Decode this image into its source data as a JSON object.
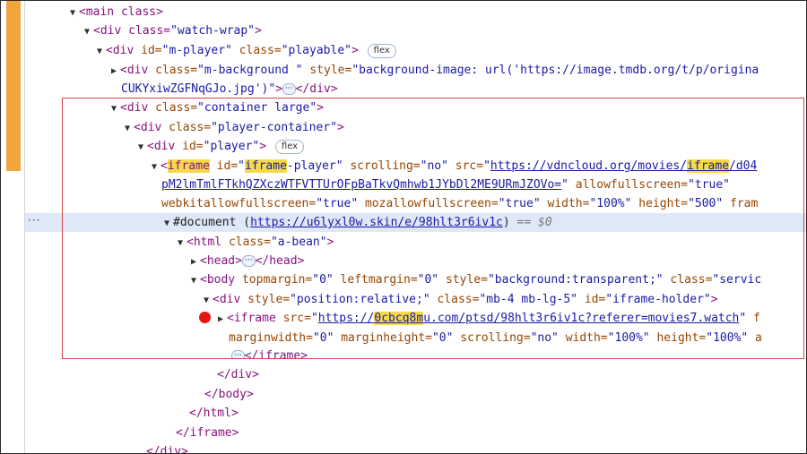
{
  "colors": {
    "tag": "#881280",
    "attr": "#994500",
    "value": "#1a1aa6",
    "highlight": "#f5d949",
    "selected_row": "#dfe8f7",
    "breakpoint": "#e31414",
    "annotation_box": "#d64545",
    "gutter_bar": "#f2a53a"
  },
  "gutter": {
    "dots": "···"
  },
  "badges": {
    "flex": "flex",
    "ellipsis": "···"
  },
  "lines": [
    {
      "t1": "<main class>"
    },
    {
      "t1": "<div class=",
      "v1": "\"watch-wrap\"",
      "t2": ">"
    },
    {
      "t1": "<div ",
      "a1": "id=",
      "v1": "\"m-player\"",
      "a2": " class=",
      "v2": "\"playable\"",
      "t2": ">"
    },
    {
      "t1": "<div ",
      "a1": "class=",
      "v1": "\"m-background \"",
      "a2": " style=",
      "v2": "\"background-image: url('https://image.tmdb.org/t/p/origina"
    },
    {
      "v1": "CUKYxiwZGFNqGJo.jpg')\"",
      "t1": ">",
      "t2": "</div>"
    },
    {
      "t1": "<div ",
      "a1": "class=",
      "v1": "\"container large\"",
      "t2": ">"
    },
    {
      "t1": "<div ",
      "a1": "class=",
      "v1": "\"player-container\"",
      "t2": ">"
    },
    {
      "t1": "<div ",
      "a1": "id=",
      "v1": "\"player\"",
      "t2": ">"
    },
    {
      "t1": "<",
      "h1": "iframe",
      "a1": " id=",
      "v1": "\"",
      "h2": "iframe",
      "v2": "-player\"",
      "a2": " scrolling=",
      "v3": "\"no\"",
      "a3": " src=",
      "v4": "\"",
      "l1": "https://vdncloud.org/movies/",
      "h3": "iframe",
      "l2": "/d04"
    },
    {
      "l1": "pM2lmTmlFTkhQZXczWTFVTTUrOFpBaTkvQmhwb1JYbDl2ME9URmJZOVo=",
      "v1": "\"",
      "a1": " allowfullscreen=",
      "v2": "\"true\""
    },
    {
      "a1": "webkitallowfullscreen=",
      "v1": "\"true\"",
      "a2": " mozallowfullscreen=",
      "v2": "\"true\"",
      "a3": " width=",
      "v3": "\"100%\"",
      "a4": " height=",
      "v4": "\"500\"",
      "a5": " fram"
    },
    {
      "t1": "#document (",
      "l1": "https://u6lyxl0w.skin/e/98hlt3r6iv1c",
      "t2": ")",
      "d1": " == $0"
    },
    {
      "t1": "<html ",
      "a1": "class=",
      "v1": "\"a-bean\"",
      "t2": ">"
    },
    {
      "t1": "<head>",
      "t2": "</head>"
    },
    {
      "t1": "<body ",
      "a1": "topmargin=",
      "v1": "\"0\"",
      "a2": " leftmargin=",
      "v2": "\"0\"",
      "a3": " style=",
      "v3": "\"background:transparent;\"",
      "a4": " class=",
      "v4": "\"servic"
    },
    {
      "t1": "<div ",
      "a1": "style=",
      "v1": "\"position:relative;\"",
      "a2": " class=",
      "v2": "\"mb-4 mb-lg-5\"",
      "a3": " id=",
      "v3": "\"iframe-holder\"",
      "t2": ">"
    },
    {
      "t1": "<iframe ",
      "a1": "src=",
      "v1": "\"",
      "l1": "https://",
      "h1": "0cbcq8m",
      "l2": "u.com/ptsd/98hlt3r6iv1c?referer=movies7.watch",
      "v2": "\"",
      "a2": " f"
    },
    {
      "a1": "marginwidth=",
      "v1": "\"0\"",
      "a2": " marginheight=",
      "v2": "\"0\"",
      "a3": " scrolling=",
      "v3": "\"no\"",
      "a4": " width=",
      "v4": "\"100%\"",
      "a5": " height=",
      "v5": "\"100%\"",
      "a6": " a"
    },
    {
      "t1": "</iframe>"
    },
    {
      "t1": "</div>"
    },
    {
      "t1": "</body>"
    },
    {
      "t1": "</html>"
    },
    {
      "t1": "</iframe>"
    },
    {
      "t1": "</div>"
    }
  ]
}
